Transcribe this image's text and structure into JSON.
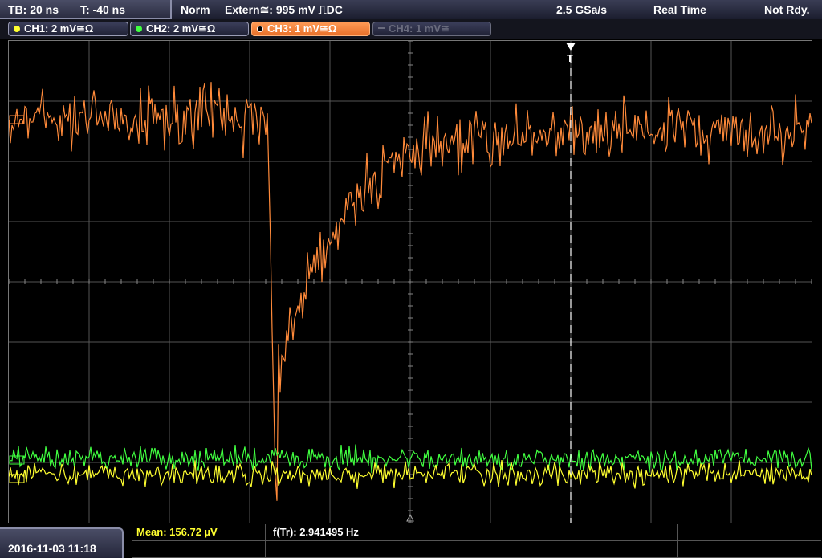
{
  "status_bar": {
    "timebase": "TB: 20 ns",
    "trigger_offset": "T: -40 ns",
    "mode": "Norm",
    "trigger_source": "Extern≅: 995 mV ⎍DC",
    "sample_rate": "2.5 GSa/s",
    "acq_mode": "Real Time",
    "state": "Not Rdy."
  },
  "channels": [
    {
      "label": "CH1: 2 mV≅Ω",
      "color": "#ffff30",
      "active": false,
      "enabled": true
    },
    {
      "label": "CH2: 2 mV≅Ω",
      "color": "#40ff40",
      "active": false,
      "enabled": true
    },
    {
      "label": "CH3: 1 mV≅Ω",
      "color": "#ff8a3a",
      "active": true,
      "enabled": true
    },
    {
      "label": "CH4: 1 mV≅",
      "color": "#6a6c7e",
      "active": false,
      "enabled": false
    }
  ],
  "trigger_marker": {
    "label": "T"
  },
  "measurements": {
    "mean": "Mean: 156.72 µV",
    "freq": "f(Tr): 2.941495 Hz"
  },
  "datetime": "2016-11-03 11:18",
  "colors": {
    "ch1": "#ffff30",
    "ch2": "#40ff40",
    "ch3": "#ff8a3a",
    "grid": "#555555",
    "mean_text": "#ffff30"
  },
  "icons": [
    "trigger-arrow-icon",
    "channel-dot-icon",
    "ground-reference-icon"
  ]
}
